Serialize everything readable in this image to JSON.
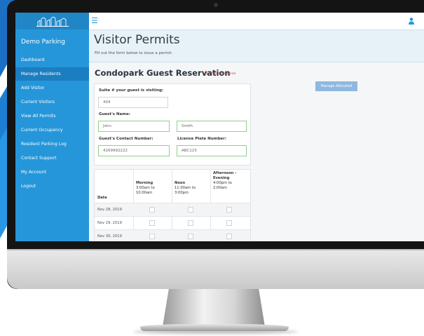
{
  "app": {
    "name": "Demo Parking"
  },
  "sidebar": {
    "items": [
      {
        "label": "Dashboard",
        "active": false
      },
      {
        "label": "Manage Residents",
        "active": true
      },
      {
        "label": "Add Visitor",
        "active": false
      },
      {
        "label": "Current Visitors",
        "active": false
      },
      {
        "label": "View All Permits",
        "active": false
      },
      {
        "label": "Current Occupancy",
        "active": false
      },
      {
        "label": "Resident Parking Log",
        "active": false
      },
      {
        "label": "Contact Support",
        "active": false
      },
      {
        "label": "My Account",
        "active": false
      },
      {
        "label": "Logout",
        "active": false
      }
    ]
  },
  "topbar": {
    "menu_icon": "hamburger-icon",
    "user_icon": "user-icon"
  },
  "header": {
    "title": "Visitor Permits",
    "subtitle": "Fill out the form below to issue a permit."
  },
  "form": {
    "title": "Condopark Guest Reservation",
    "required_note": "All fields are required",
    "suite_label": "Suite # your guest is visiting:",
    "suite_value": "404",
    "name_label": "Guest's Name:",
    "first_name_value": "John",
    "last_name_value": "Smith",
    "contact_label": "Guest's Contact Number:",
    "contact_value": "4169992222",
    "plate_label": "License Plate Number:",
    "plate_value": "ABC123"
  },
  "actions": {
    "manage_allocated_label": "Manage Allocated"
  },
  "schedule": {
    "date_header": "Date",
    "columns": [
      {
        "title": "Morning",
        "time": "3:00am to 10:00am"
      },
      {
        "title": "Noon",
        "time": "11:00am to 3:00pm"
      },
      {
        "title": "Afternoon - Evening",
        "time": "4:00pm to 2:00am"
      }
    ],
    "rows": [
      {
        "date": "Nov 28, 2019"
      },
      {
        "date": "Nov 29, 2019"
      },
      {
        "date": "Nov 30, 2019"
      }
    ]
  },
  "colors": {
    "sidebar": "#2596d9",
    "sidebar_active": "#1b7ec0",
    "header_panel": "#e6f1f8",
    "button": "#8fb8de",
    "required": "#e03a2f",
    "valid_border": "#8fd08c"
  }
}
